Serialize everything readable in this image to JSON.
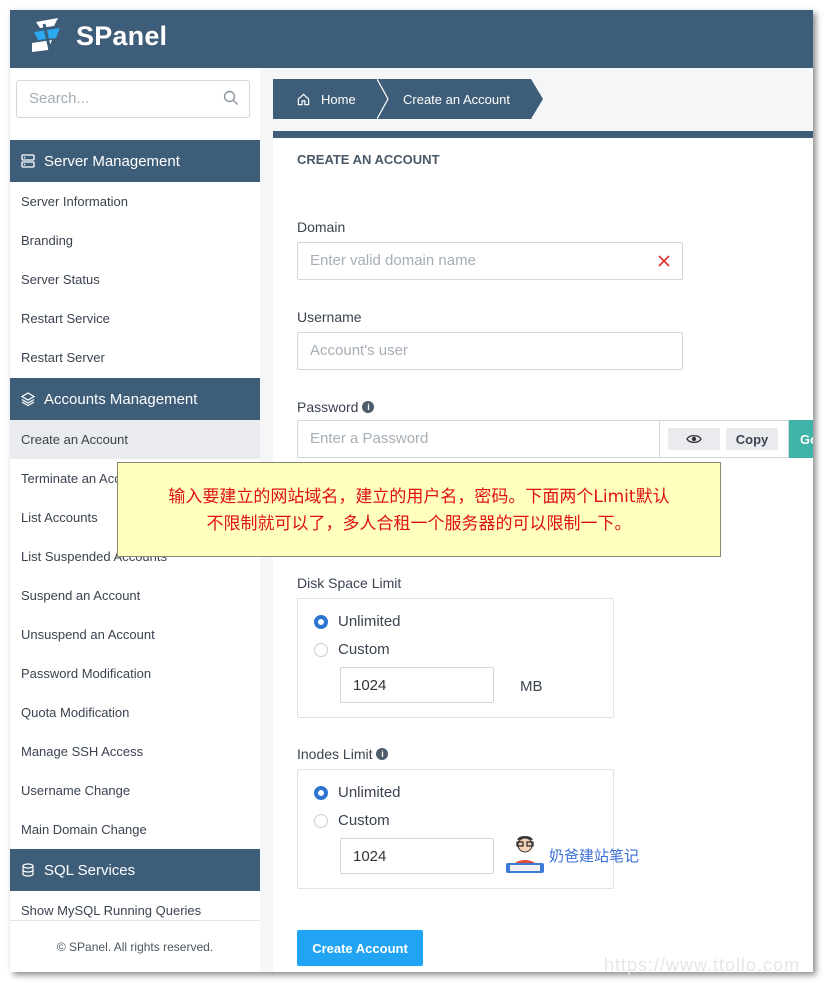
{
  "app": {
    "name": "SPanel"
  },
  "search": {
    "placeholder": "Search..."
  },
  "sidebar": {
    "server_management": {
      "title": "Server Management",
      "items": [
        "Server Information",
        "Branding",
        "Server Status",
        "Restart Service",
        "Restart Server"
      ]
    },
    "accounts_management": {
      "title": "Accounts Management",
      "items": [
        "Create an Account",
        "Terminate an Account",
        "List Accounts",
        "List Suspended Accounts",
        "Suspend an Account",
        "Unsuspend an Account",
        "Password Modification",
        "Quota Modification",
        "Manage SSH Access",
        "Username Change",
        "Main Domain Change"
      ],
      "active_index": 0
    },
    "sql_services": {
      "title": "SQL Services",
      "items": [
        "Show MySQL Running Queries"
      ]
    },
    "footer": "© SPanel. All rights reserved."
  },
  "breadcrumb": {
    "home": "Home",
    "current": "Create an Account"
  },
  "form": {
    "title": "CREATE AN ACCOUNT",
    "domain": {
      "label": "Domain",
      "placeholder": "Enter valid domain name"
    },
    "username": {
      "label": "Username",
      "placeholder": "Account's user"
    },
    "password": {
      "label": "Password",
      "placeholder": "Enter a Password",
      "copy_label": "Copy",
      "generate_label": "Go"
    },
    "disk_limit": {
      "label": "Disk Space Limit",
      "unlimited": "Unlimited",
      "custom": "Custom",
      "value": "1024",
      "unit": "MB",
      "selected": "Unlimited"
    },
    "inodes_limit": {
      "label": "Inodes Limit",
      "unlimited": "Unlimited",
      "custom": "Custom",
      "value": "1024",
      "selected": "Unlimited"
    },
    "submit_label": "Create Account"
  },
  "annotation": {
    "line1": "输入要建立的网站域名，建立的用户名，密码。下面两个Limit默认",
    "line2": "不限制就可以了，多人合租一个服务器的可以限制一下。"
  },
  "watermark": {
    "text": "奶爸建站笔记",
    "url": "https://www.ttollo.com"
  },
  "colors": {
    "header": "#3e5d78",
    "accent": "#20a4f3",
    "note_bg": "#ffffc0",
    "note_text": "#e01010",
    "radio": "#2d74d0"
  }
}
